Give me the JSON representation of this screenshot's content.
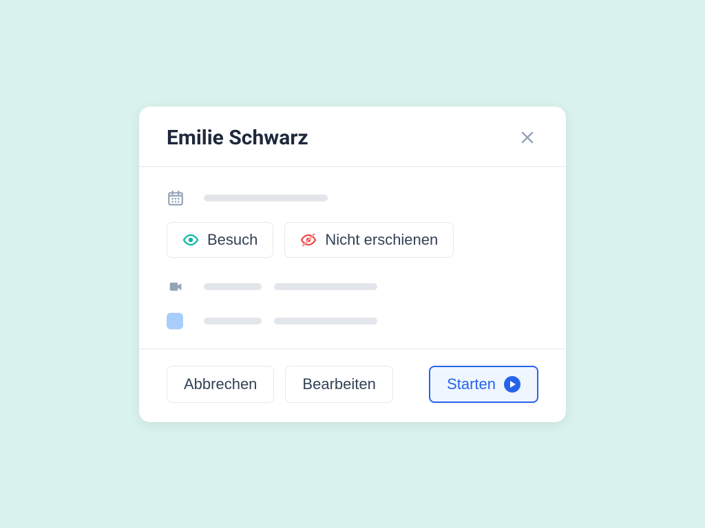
{
  "card": {
    "title": "Emilie Schwarz"
  },
  "status": {
    "visit_label": "Besuch",
    "no_show_label": "Nicht erschienen"
  },
  "actions": {
    "cancel": "Abbrechen",
    "edit": "Bearbeiten",
    "start": "Starten"
  },
  "colors": {
    "accent_blue": "#2563eb",
    "teal": "#06b6a4",
    "red": "#ef4444",
    "swatch": "#a9cdfb"
  }
}
